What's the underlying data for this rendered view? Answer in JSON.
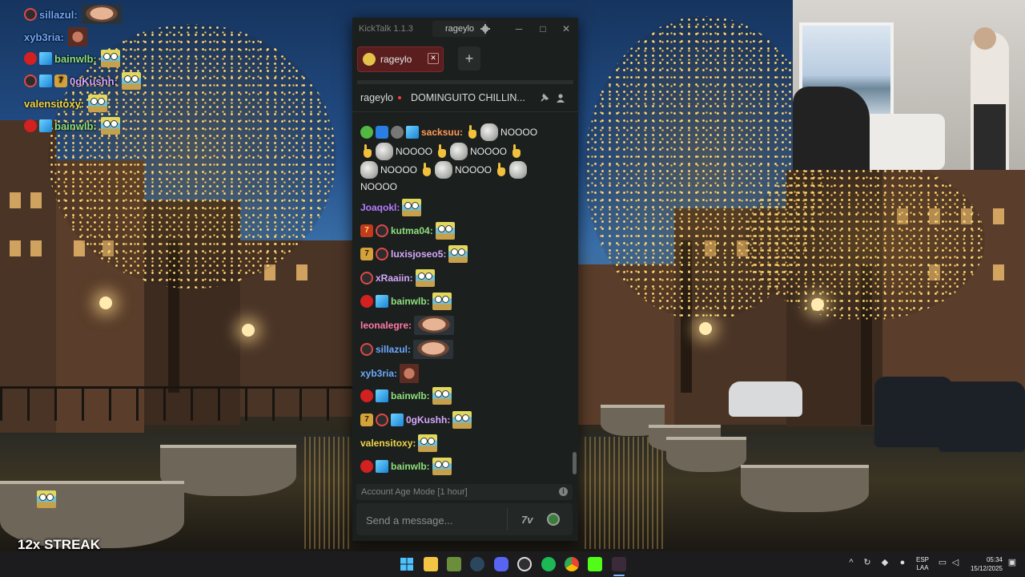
{
  "overlay_chat": [
    {
      "user": "sillazul:"
    },
    {
      "user": "xyb3ria:"
    },
    {
      "user": "bainwlb:"
    },
    {
      "user": "0gKushh:"
    },
    {
      "user": "valensitoxy:"
    },
    {
      "user": "bainwlb:"
    }
  ],
  "streak": "12x STREAK",
  "kicktalk": {
    "app_name": "KickTalk 1.1.3",
    "user_button": "rageylo",
    "tab": {
      "label": "rageylo"
    },
    "add_tab": "+",
    "channel": "rageylo",
    "stream_title": "DOMINGUITO CHILLIN...",
    "messages": [
      {
        "user": "sacksuu:",
        "text": "NOOOO"
      },
      {
        "text_repeat": "NOOOO"
      },
      {
        "user": "Joaqokl:"
      },
      {
        "user": "kutma04:"
      },
      {
        "user": "luxisjoseo5:"
      },
      {
        "user": "xRaaiin:"
      },
      {
        "user": "bainwlb:"
      },
      {
        "user": "leonalegre:"
      },
      {
        "user": "sillazul:"
      },
      {
        "user": "xyb3ria:"
      },
      {
        "user": "bainwlb:"
      },
      {
        "user": "0gKushh:"
      },
      {
        "user": "valensitoxy:"
      },
      {
        "user": "bainwlb:"
      }
    ],
    "age_mode": "Account Age Mode [1 hour]",
    "input_placeholder": "Send a message...",
    "emote_picker_7tv": "7v"
  },
  "taskbar": {
    "lang_line1": "ESP",
    "lang_line2": "LAA",
    "time": "05:34",
    "date": "15/12/2025"
  },
  "icons": [
    "windows-start-icon",
    "file-explorer-icon",
    "app-icon",
    "steam-icon",
    "discord-icon",
    "obs-icon",
    "spotify-icon",
    "chrome-icon",
    "kick-icon",
    "steam-active-icon"
  ]
}
